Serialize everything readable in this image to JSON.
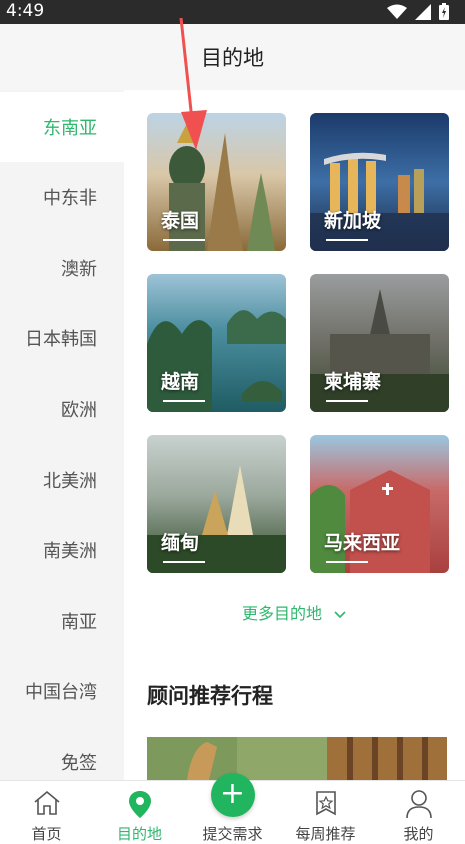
{
  "status_bar": {
    "time": "4:49",
    "icons": [
      "wifi-icon",
      "signal-icon",
      "battery-icon"
    ]
  },
  "header": {
    "title": "目的地"
  },
  "sidebar": {
    "items": [
      {
        "label": "东南亚",
        "active": true
      },
      {
        "label": "中东非"
      },
      {
        "label": "澳新"
      },
      {
        "label": "日本韩国"
      },
      {
        "label": "欧洲"
      },
      {
        "label": "北美洲"
      },
      {
        "label": "南美洲"
      },
      {
        "label": "南亚"
      },
      {
        "label": "中国台湾"
      },
      {
        "label": "免签"
      }
    ]
  },
  "destinations": [
    {
      "label": "泰国"
    },
    {
      "label": "新加坡"
    },
    {
      "label": "越南"
    },
    {
      "label": "柬埔寨"
    },
    {
      "label": "缅甸"
    },
    {
      "label": "马来西亚"
    }
  ],
  "more_link": {
    "label": "更多目的地"
  },
  "section": {
    "title": "顾问推荐行程"
  },
  "tabbar": {
    "items": [
      {
        "label": "首页",
        "icon": "home-icon"
      },
      {
        "label": "目的地",
        "icon": "location-pin-icon",
        "active": true
      },
      {
        "label": "提交需求",
        "icon": "plus-icon"
      },
      {
        "label": "每周推荐",
        "icon": "star-badge-icon"
      },
      {
        "label": "我的",
        "icon": "user-icon"
      }
    ]
  },
  "colors": {
    "accent": "#2fb76e",
    "fab": "#22b55f",
    "annotation_arrow": "#f05050"
  }
}
